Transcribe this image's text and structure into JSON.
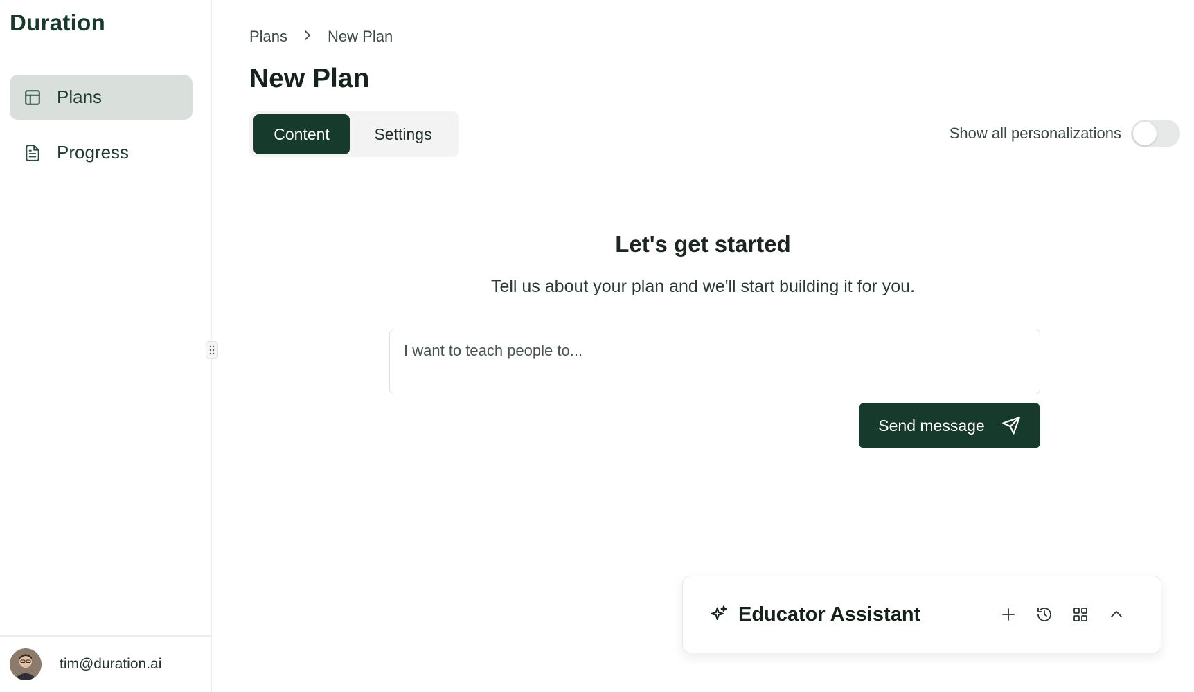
{
  "app": {
    "name": "Duration"
  },
  "sidebar": {
    "items": [
      {
        "label": "Plans",
        "icon": "layout-icon",
        "active": true
      },
      {
        "label": "Progress",
        "icon": "file-text-icon",
        "active": false
      }
    ],
    "user": {
      "email": "tim@duration.ai"
    }
  },
  "breadcrumb": {
    "root": "Plans",
    "current": "New Plan"
  },
  "page": {
    "title": "New Plan"
  },
  "tabs": [
    {
      "label": "Content",
      "active": true
    },
    {
      "label": "Settings",
      "active": false
    }
  ],
  "personalizations": {
    "label": "Show all personalizations",
    "enabled": false
  },
  "hero": {
    "title": "Let's get started",
    "subtitle": "Tell us about your plan and we'll start building it for you."
  },
  "prompt": {
    "placeholder": "I want to teach people to...",
    "value": ""
  },
  "send_button": {
    "label": "Send message",
    "icon": "send-icon"
  },
  "assistant": {
    "title": "Educator Assistant",
    "icon": "sparkles-icon",
    "actions": [
      "plus-icon",
      "history-icon",
      "grid-icon",
      "chevron-up-icon"
    ]
  },
  "colors": {
    "brand": "#163a2c",
    "active_nav": "#d9dfdb",
    "tab_bg": "#f3f3f3"
  }
}
